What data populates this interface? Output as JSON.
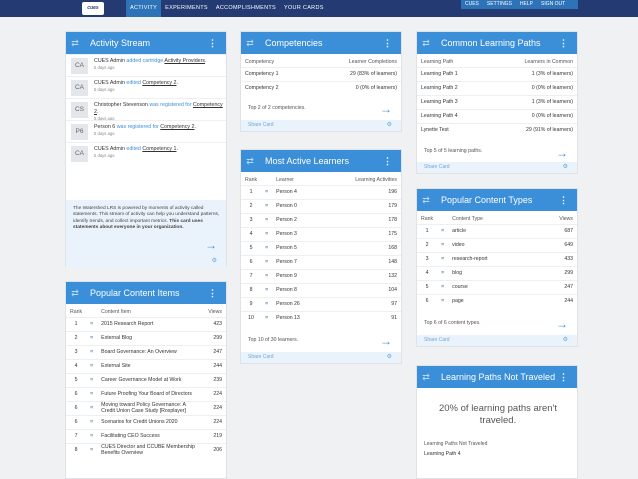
{
  "header": {
    "logo": "cues",
    "nav": [
      "ACTIVITY",
      "EXPERIMENTS",
      "ACCOMPLISHMENTS",
      "YOUR CARDS"
    ],
    "right_nav": [
      "CUES",
      "SETTINGS",
      "HELP",
      "SIGN OUT"
    ]
  },
  "common": {
    "share_card": "Share Card"
  },
  "activity": {
    "title": "Activity Stream",
    "items": [
      {
        "avatar": "CA",
        "actor": "CUES Admin",
        "verb": "added cartridge",
        "object": "Activity Providers",
        "suffix": ".",
        "when": "5 days ago"
      },
      {
        "avatar": "CA",
        "actor": "CUES Admin",
        "verb": "edited",
        "object": "Competency 2",
        "suffix": ".",
        "when": "5 days ago"
      },
      {
        "avatar": "CS",
        "actor": "Christopher Stevenson",
        "verb": "was registered for",
        "object": "Competency 2",
        "suffix": ".",
        "when": "5 days ago"
      },
      {
        "avatar": "P6",
        "actor": "Person 6",
        "verb": "was registered for",
        "object": "Competency 2",
        "suffix": ".",
        "when": "5 days ago"
      },
      {
        "avatar": "CA",
        "actor": "CUES Admin",
        "verb": "edited",
        "object": "Competency 1",
        "suffix": ".",
        "when": "5 days ago"
      }
    ],
    "info": "The Watershed LRS is powered by moments of activity called statements. This stream of activity can help you understand patterns, identify trends, and collect important metrics.",
    "info_bold": "This card uses statements about everyone in your organization."
  },
  "content_items": {
    "title": "Popular Content Items",
    "headers": [
      "Rank",
      "Content Item",
      "Views"
    ],
    "rows": [
      {
        "rank": "1",
        "item": "2015 Research Report",
        "views": "423"
      },
      {
        "rank": "2",
        "item": "External Blog",
        "views": "299"
      },
      {
        "rank": "3",
        "item": "Board Governance: An Overview",
        "views": "247"
      },
      {
        "rank": "4",
        "item": "External Site",
        "views": "244"
      },
      {
        "rank": "5",
        "item": "Career Governance Model at Work",
        "views": "239"
      },
      {
        "rank": "6",
        "item": "Future Proofing Your Board of Directors",
        "views": "224"
      },
      {
        "rank": "6",
        "item": "Moving toward Policy Governance: A Credit Union Case Study [Roxplayer]",
        "views": "224"
      },
      {
        "rank": "6",
        "item": "Scenarios for Credit Unions 2020",
        "views": "224"
      },
      {
        "rank": "7",
        "item": "Facilitating CEO Success",
        "views": "219"
      },
      {
        "rank": "8",
        "item": "CUES Director and CCUBE Membership Benefits Overview",
        "views": "206"
      }
    ]
  },
  "competencies": {
    "title": "Competencies",
    "headers": [
      "Competency",
      "Learner Completions"
    ],
    "rows": [
      {
        "name": "Competency 1",
        "value": "29 (83% of learners)"
      },
      {
        "name": "Competency 2",
        "value": "0 (0% of learners)"
      }
    ],
    "footer": "Top 2 of 2 competencies."
  },
  "learners": {
    "title": "Most Active Learners",
    "headers": [
      "Rank",
      "Learner",
      "Learning Activities"
    ],
    "rows": [
      {
        "rank": "1",
        "name": "Person 4",
        "value": "196"
      },
      {
        "rank": "2",
        "name": "Person 0",
        "value": "179"
      },
      {
        "rank": "3",
        "name": "Person 2",
        "value": "178"
      },
      {
        "rank": "4",
        "name": "Person 3",
        "value": "175"
      },
      {
        "rank": "5",
        "name": "Person 5",
        "value": "168"
      },
      {
        "rank": "6",
        "name": "Person 7",
        "value": "148"
      },
      {
        "rank": "7",
        "name": "Person 9",
        "value": "132"
      },
      {
        "rank": "8",
        "name": "Person 8",
        "value": "104"
      },
      {
        "rank": "9",
        "name": "Person 26",
        "value": "97"
      },
      {
        "rank": "10",
        "name": "Person 13",
        "value": "91"
      }
    ],
    "footer": "Top 10 of 30 learners."
  },
  "paths": {
    "title": "Common Learning Paths",
    "headers": [
      "Learning Path",
      "Learners in Common"
    ],
    "rows": [
      {
        "name": "Learning Path 1",
        "value": "1 (3% of learners)"
      },
      {
        "name": "Learning Path 2",
        "value": "0 (0% of learners)"
      },
      {
        "name": "Learning Path 3",
        "value": "1 (3% of learners)"
      },
      {
        "name": "Learning Path 4",
        "value": "0 (0% of learners)"
      },
      {
        "name": "Lynette Test",
        "value": "29 (91% of learners)"
      }
    ],
    "footer": "Top 5 of 5 learning paths."
  },
  "types": {
    "title": "Popular Content Types",
    "headers": [
      "Rank",
      "Content Type",
      "Views"
    ],
    "rows": [
      {
        "rank": "1",
        "name": "article",
        "value": "687"
      },
      {
        "rank": "2",
        "name": "video",
        "value": "649"
      },
      {
        "rank": "3",
        "name": "research-report",
        "value": "433"
      },
      {
        "rank": "4",
        "name": "blog",
        "value": "299"
      },
      {
        "rank": "5",
        "name": "course",
        "value": "247"
      },
      {
        "rank": "6",
        "name": "page",
        "value": "244"
      }
    ],
    "footer": "Top 6 of 6 content types."
  },
  "not_traveled": {
    "title": "Learning Paths Not Traveled",
    "big": "20% of learning paths aren't traveled.",
    "label": "Learning Paths Not Traveled",
    "value": "Learning Path 4"
  }
}
